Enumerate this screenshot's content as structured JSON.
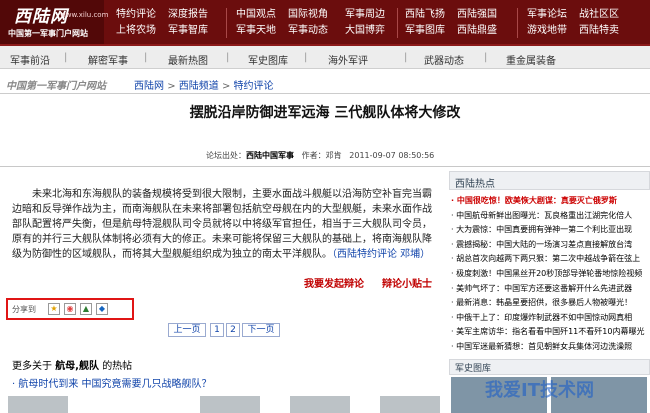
{
  "header": {
    "logo": {
      "name": "西陆网",
      "url": "www.xilu.com",
      "tagline": "中国第一军事门户网站"
    },
    "nav": [
      [
        "特约评论",
        "深度报告",
        "上将农场",
        "军事智库"
      ],
      [
        "中国观点",
        "国际视角",
        "军事天地",
        "军事动态"
      ],
      [
        "军事周边",
        "大国博弈"
      ],
      [
        "西陆飞扬",
        "西陆强国",
        "军事图库",
        "西陆鼎盛"
      ],
      [
        "军事论坛",
        "战社区区",
        "游戏地带",
        "西陆特卖"
      ]
    ]
  },
  "subnav": [
    "军事前沿",
    "解密军事",
    "最新热图",
    "军史图库",
    "海外军评",
    "武器动态",
    "重金属装备"
  ],
  "breadcrumb": {
    "tagline": "中国第一军事门户网站",
    "items": [
      "西陆网",
      "西陆频道",
      "特约评论"
    ]
  },
  "article": {
    "title": "摆脱沿岸防御进军远海 三代舰队体将大修改",
    "meta_prefix": "论坛出处：",
    "meta_source": "西陆中国军事",
    "meta_author": "作者：邓肯",
    "meta_time": "2011-09-07 08:50:56",
    "body": "未来北海和东海舰队的装备规模将受到很大限制，主要水面战斗舰艇以沿海防空补盲完当霸边暗和反导弹作战为主，而南海舰队在未来将部署包括航空母舰在内的大型舰艇，未来水面作战部队配置将严失衡，但是航母特混舰队司令员就将以中将级军官担任，相当于三大舰队司令员，原有的并行三大舰队体制将必须有大的修正。未来可能将保留三大舰队的基础上，将南海舰队降级为防御性的区域舰队，而将其大型舰艇组织成为独立的南太平洋舰队。",
    "source_link": "（西陆特约评论 邓埔）",
    "action_debate": "我要发起辩论",
    "action_tips": "辩论小贴士"
  },
  "share": {
    "label": "分享到"
  },
  "pagination": {
    "prev": "上一页",
    "pages": [
      "1",
      "2"
    ],
    "next": "下一页"
  },
  "related": {
    "prefix": "更多关于",
    "keywords": "航母,舰队",
    "suffix": "的热帖",
    "items": [
      "· 航母时代到来 中国究竟需要几只战略舰队？"
    ]
  },
  "sidebar": {
    "hot_title": "西陆热点",
    "hot_items": [
      "· 中国很吃惊！欧美恢大剧谋：真要灭亡俄罗斯",
      "· 中国航母新鲜出图曝光：瓦良格重出江湖完化倍人",
      "· 大为震惊：中国真要拥有弹神一第二个利比亚出现",
      "· 震撼揭秘：中国大陆的一场演习差点直接解放台湾",
      "· 胡总首次向越两下两只狠：第二次中越战争箭在弦上",
      "· 极度刺激！中国黑丝开20秒顶部导弹轮番地惊险视频",
      "· 美帅气坏了：中国军方还要这番解开什么先进武器",
      "· 最新消息：韩晶星要招供，很多暴后人物被曝光！",
      "· 中俄干上了：印度爆炸制武器不如中国惊动网真相",
      "· 美军主席访华：指名看看中国歼11不看歼10内幕曝光",
      "· 中国军迷最新猜想：首见朝鲜女兵集体河边洗澡照"
    ],
    "red_items": [
      0
    ],
    "pics_title": "军史图库"
  },
  "watermark": "我爱IT技术网"
}
